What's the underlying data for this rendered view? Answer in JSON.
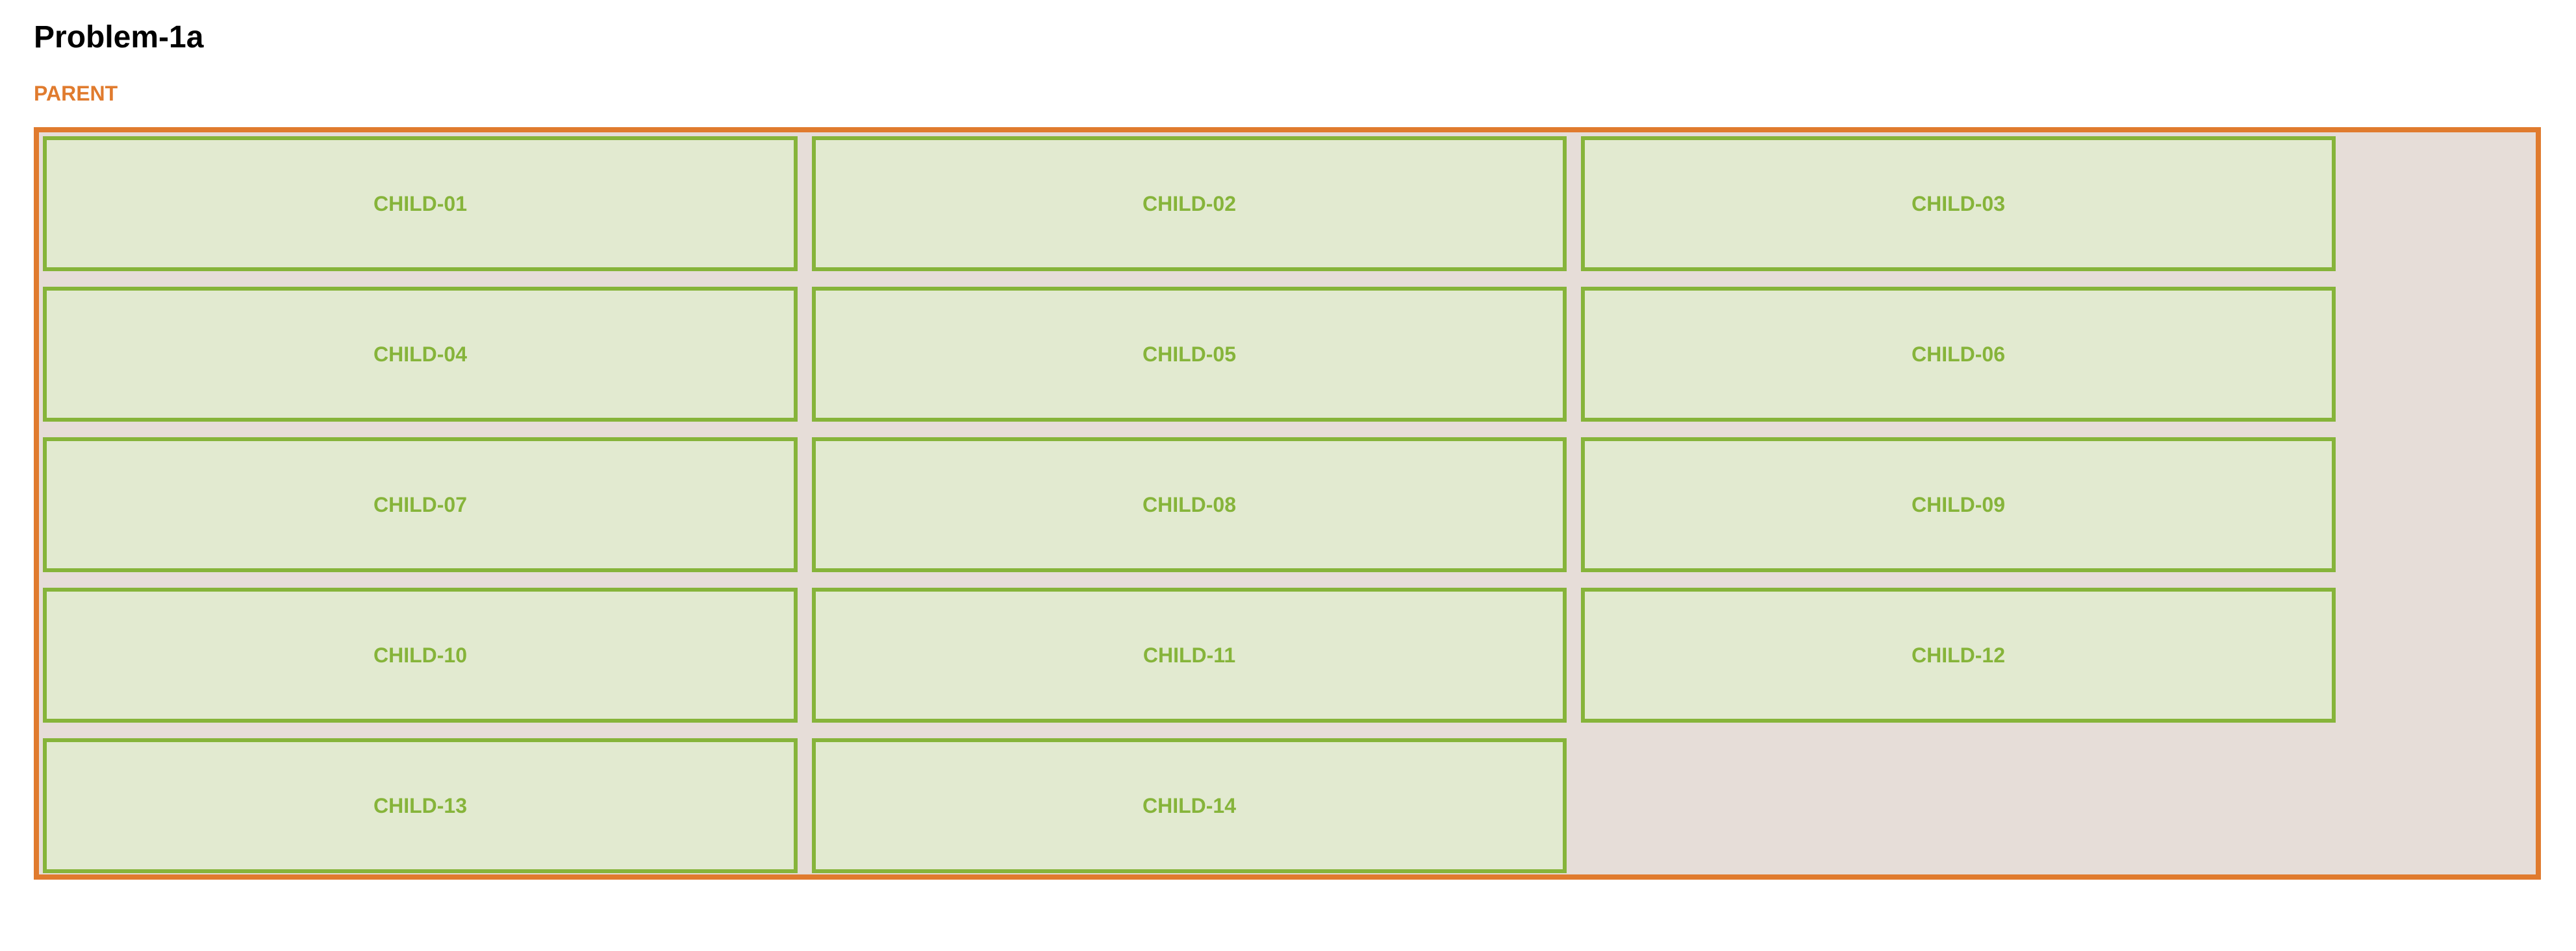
{
  "page": {
    "title": "Problem-1a"
  },
  "parent": {
    "label": "PARENT",
    "border_color": "#e07b2e",
    "background_color": "#e6ddd8"
  },
  "children": {
    "border_color": "#86b43a",
    "background_color": "#e2ead0",
    "items": [
      {
        "label": "CHILD-01"
      },
      {
        "label": "CHILD-02"
      },
      {
        "label": "CHILD-03"
      },
      {
        "label": "CHILD-04"
      },
      {
        "label": "CHILD-05"
      },
      {
        "label": "CHILD-06"
      },
      {
        "label": "CHILD-07"
      },
      {
        "label": "CHILD-08"
      },
      {
        "label": "CHILD-09"
      },
      {
        "label": "CHILD-10"
      },
      {
        "label": "CHILD-11"
      },
      {
        "label": "CHILD-12"
      },
      {
        "label": "CHILD-13"
      },
      {
        "label": "CHILD-14"
      }
    ]
  }
}
